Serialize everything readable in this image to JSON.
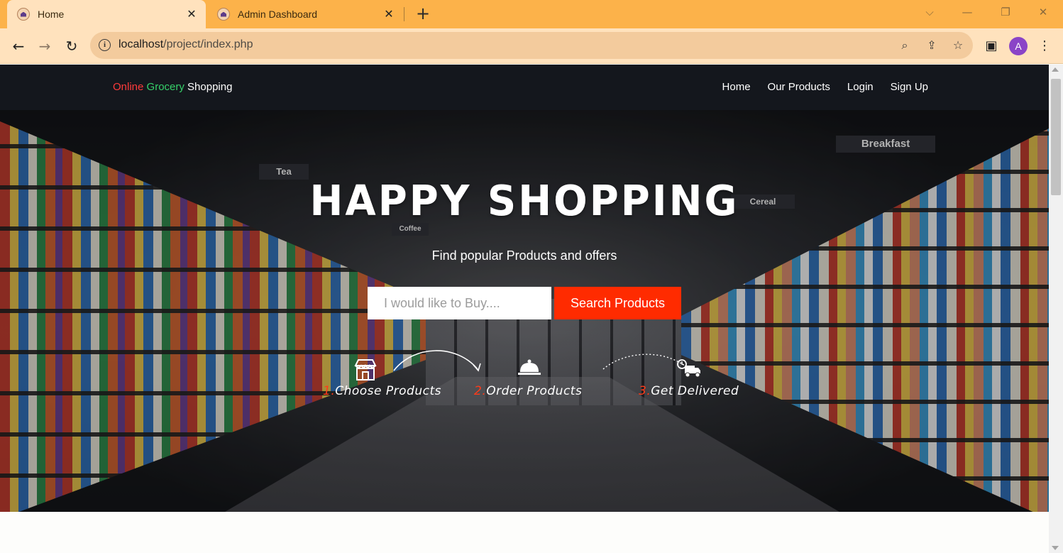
{
  "browser": {
    "tabs": [
      {
        "title": "Home",
        "active": true
      },
      {
        "title": "Admin Dashboard",
        "active": false
      }
    ],
    "url_host": "localhost",
    "url_path": "/project/index.php",
    "profile_initial": "A"
  },
  "site": {
    "brand": {
      "word1": "Online",
      "word2": "Grocery",
      "word3": "Shopping"
    },
    "nav": [
      "Home",
      "Our Products",
      "Login",
      "Sign Up"
    ],
    "hero": {
      "title": "HAPPY SHOPPING",
      "subtitle": "Find popular Products and offers",
      "search_placeholder": "I would like to Buy....",
      "search_button": "Search Products"
    },
    "steps": [
      {
        "num": "1.",
        "label": "Choose Products",
        "icon": "store-icon"
      },
      {
        "num": "2.",
        "label": "Order Products",
        "icon": "cloche-icon"
      },
      {
        "num": "3.",
        "label": "Get Delivered",
        "icon": "delivery-truck-icon"
      }
    ],
    "background_signs": [
      "Tea",
      "Breakfast",
      "Cereal",
      "Coffee"
    ]
  },
  "colors": {
    "tabbar": "#fcb24a",
    "toolbar": "#ffe2bd",
    "brand_red": "#ff3b3b",
    "brand_green": "#36d16a",
    "search_button": "#ff2b00",
    "avatar": "#8a44c7"
  }
}
